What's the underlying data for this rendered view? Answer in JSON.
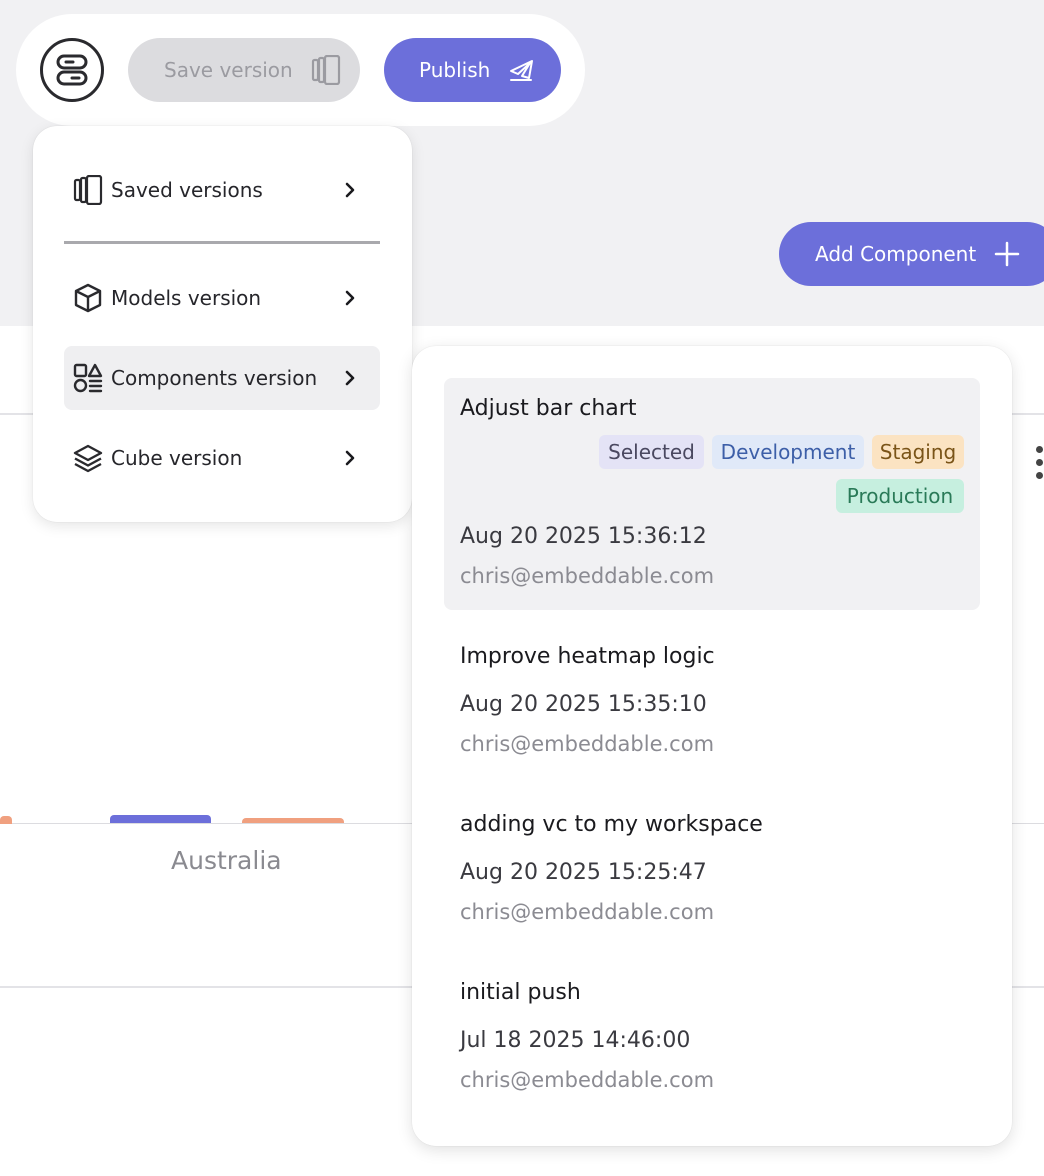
{
  "toolbar": {
    "menu_icon": "server-toggle-icon",
    "save_label": "Save version",
    "save_icon": "versions-icon",
    "publish_label": "Publish",
    "publish_icon": "publish-plane-icon",
    "add_component_label": "Add Component",
    "add_component_icon": "plus-icon"
  },
  "menu": {
    "items": [
      {
        "label": "Saved versions",
        "icon": "versions-icon"
      },
      {
        "label": "Models version",
        "icon": "cube-icon"
      },
      {
        "label": "Components version",
        "icon": "components-icon"
      },
      {
        "label": "Cube version",
        "icon": "layers-icon"
      }
    ]
  },
  "background": {
    "axis_label": "Australia"
  },
  "versions": [
    {
      "title": "Adjust bar chart",
      "tags": [
        "Selected",
        "Development",
        "Staging",
        "Production"
      ],
      "date": "Aug 20 2025 15:36:12",
      "email": "chris@embeddable.com"
    },
    {
      "title": "Improve heatmap logic",
      "date": "Aug 20 2025 15:35:10",
      "email": "chris@embeddable.com"
    },
    {
      "title": "adding vc to my workspace",
      "date": "Aug 20 2025 15:25:47",
      "email": "chris@embeddable.com"
    },
    {
      "title": "initial push",
      "date": "Jul 18 2025 14:46:00",
      "email": "chris@embeddable.com"
    }
  ],
  "colors": {
    "accent": "#6c6fda",
    "tag_selected_bg": "#e4e3f6",
    "tag_development_bg": "#e0e9f8",
    "tag_staging_bg": "#fbe3c2",
    "tag_production_bg": "#c6efdf"
  }
}
